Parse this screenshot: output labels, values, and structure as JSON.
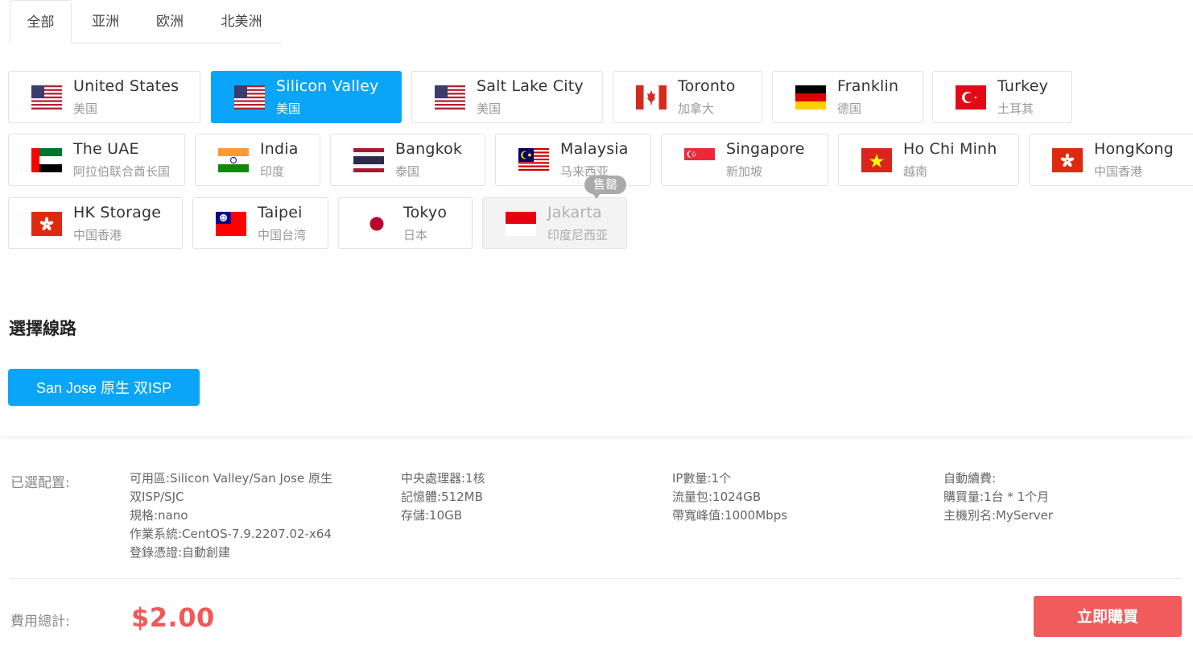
{
  "tabs": [
    {
      "label": "全部",
      "active": true
    },
    {
      "label": "亚洲"
    },
    {
      "label": "欧洲"
    },
    {
      "label": "北美洲"
    }
  ],
  "regions": [
    {
      "name": "United States",
      "sub": "美国",
      "flag": "us-flag"
    },
    {
      "name": "Silicon Valley",
      "sub": "美国",
      "flag": "us-flag",
      "selected": true
    },
    {
      "name": "Salt Lake City",
      "sub": "美国",
      "flag": "us-flag"
    },
    {
      "name": "Toronto",
      "sub": "加拿大",
      "flag": "ca-flag"
    },
    {
      "name": "Franklin",
      "sub": "德国",
      "flag": "de-flag"
    },
    {
      "name": "Turkey",
      "sub": "土耳其",
      "flag": "tr-flag"
    },
    {
      "name": "The UAE",
      "sub": "阿拉伯联合酋长国",
      "flag": "ae-flag"
    },
    {
      "name": "India",
      "sub": "印度",
      "flag": "in-flag"
    },
    {
      "name": "Bangkok",
      "sub": "泰国",
      "flag": "th-flag"
    },
    {
      "name": "Malaysia",
      "sub": "马来西亚",
      "flag": "my-flag"
    },
    {
      "name": "Singapore",
      "sub": "新加坡",
      "flag": "sg-flag"
    },
    {
      "name": "Ho Chi Minh",
      "sub": "越南",
      "flag": "vn-flag"
    },
    {
      "name": "HongKong",
      "sub": "中国香港",
      "flag": "hk-flag"
    },
    {
      "name": "HK Storage",
      "sub": "中国香港",
      "flag": "hk-flag"
    },
    {
      "name": "Taipei",
      "sub": "中国台湾",
      "flag": "tw-flag"
    },
    {
      "name": "Tokyo",
      "sub": "日本",
      "flag": "jp-flag"
    },
    {
      "name": "Jakarta",
      "sub": "印度尼西亚",
      "flag": "id-flag",
      "soldout": true
    }
  ],
  "soldout_tag": "售罄",
  "line_section": {
    "title": "選擇線路",
    "selected_line": "San Jose 原生 双ISP"
  },
  "config": {
    "label": "已選配置:",
    "col1": [
      "可用區:Silicon Valley/San Jose 原生",
      "双ISP/SJC",
      "規格:nano",
      "作業系統:CentOS-7.9.2207.02-x64",
      "登錄憑證:自動創建"
    ],
    "col2": [
      "中央處理器:1核",
      "記憶體:512MB",
      "存儲:10GB"
    ],
    "col3": [
      "IP數量:1个",
      "流量包:1024GB",
      "帶寬峰值:1000Mbps"
    ],
    "col4": [
      "自動續費:",
      "購買量:1台 * 1个月",
      "主機別名:MyServer"
    ]
  },
  "total": {
    "label": "費用總計:",
    "price": "$2.00",
    "buy_label": "立即購買"
  },
  "colors": {
    "accent": "#0aa5f6",
    "price": "#f25858",
    "buy": "#f25b5b"
  }
}
